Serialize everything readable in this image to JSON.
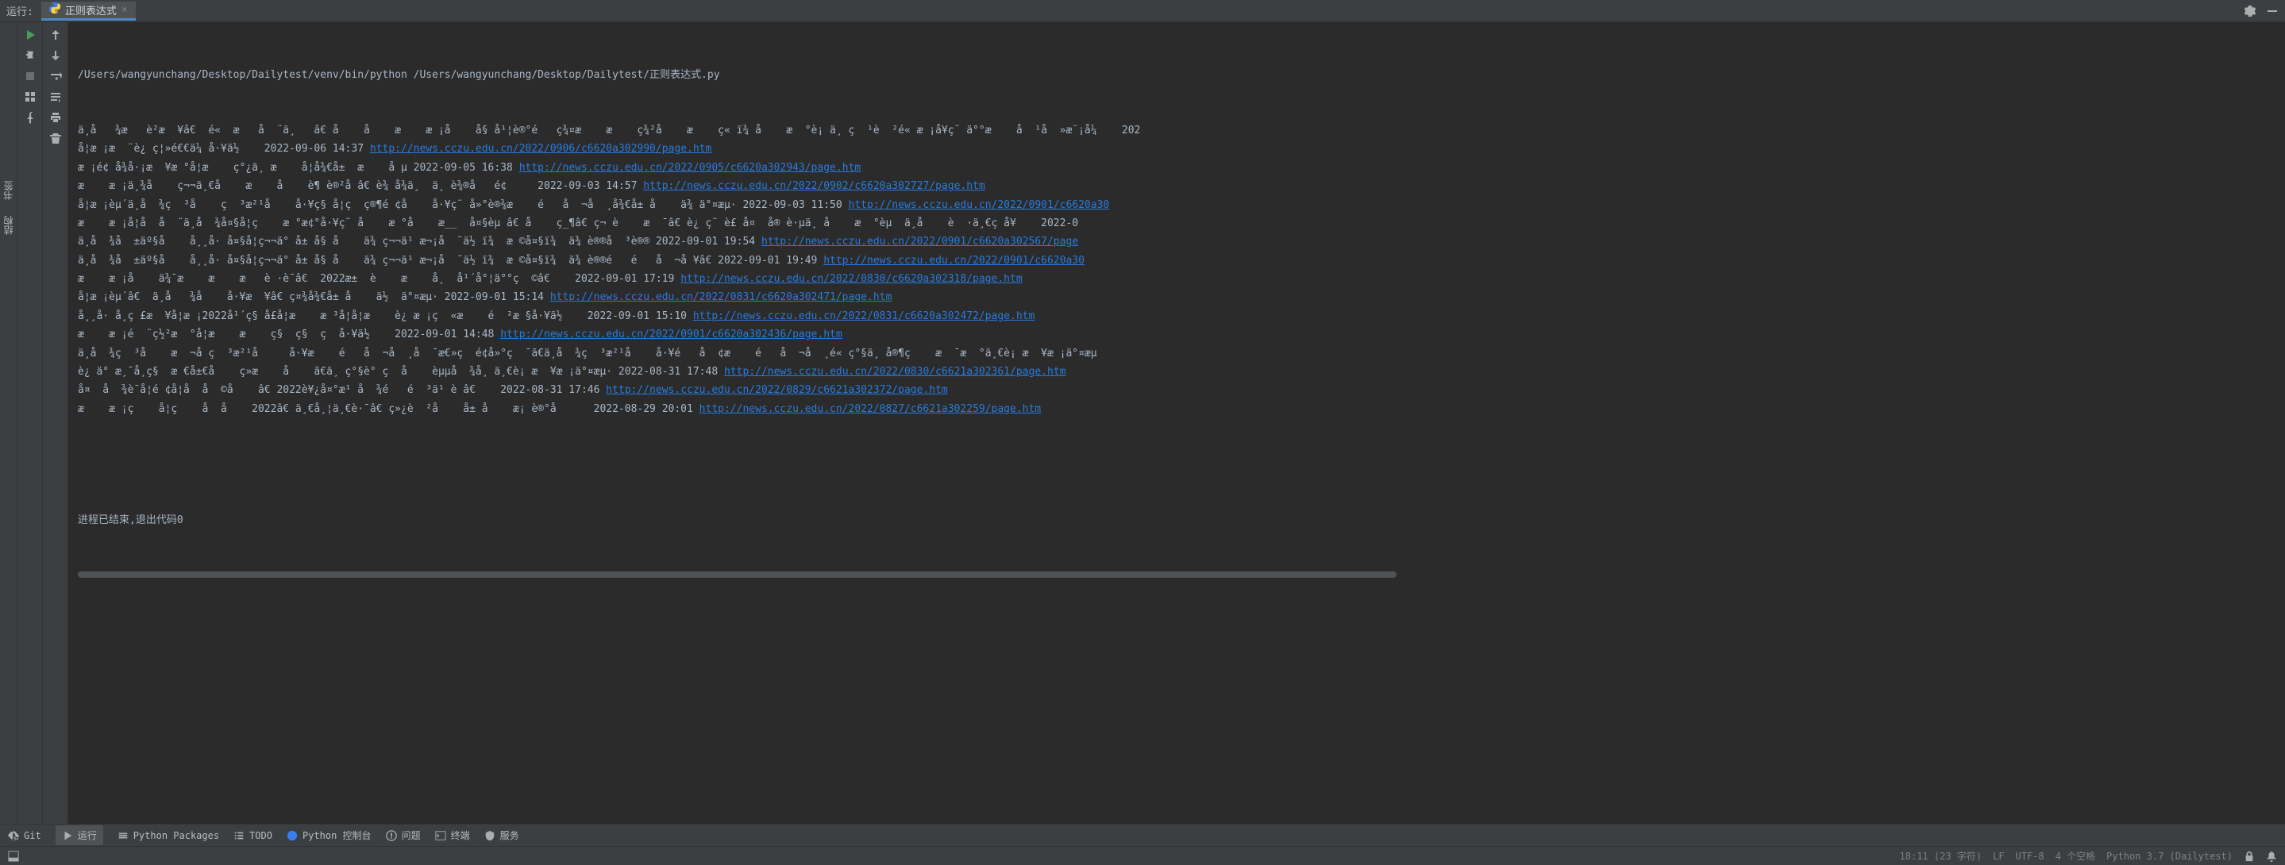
{
  "header": {
    "run_label": "运行:",
    "tab_name": "正则表达式",
    "close_glyph": "×"
  },
  "console": {
    "command": "/Users/wangyunchang/Desktop/Dailytest/venv/bin/python /Users/wangyunchang/Desktop/Dailytest/正则表达式.py",
    "lines": [
      {
        "text": "ä¸­å   ¾æ   è­²æ  ¥â€  é«  æ   å  ¨ä¸   â€ å    å    æ    æ ¡å    å§ å¹¦è®°é   ç¾¤æ    æ    ç¾²å    æ    ç« ï¾ å    æ  °è¡ ä¸ ç  ¹è  ²é« æ ¡å­¥ç¨ ä°°æ    å  ¹å  »æ¨¡å¼    202",
        "url": ""
      },
      {
        "text": "å­¦æ ¡æ  ¨è¿ ç¦»é€€ä¼ å·¥ä½    2022-09-06 14:37 ",
        "url": "http://news.cczu.edu.cn/2022/0906/c6620a302990/page.htm"
      },
      {
        "text": "æ ¡é¢ å­¾å·¡æ  ¥æ °å­¦æ    ç°¿ä¸ æ    å­¦å¾€å±  æ    å µ 2022-09-05 16:38 ",
        "url": "http://news.cczu.edu.cn/2022/0905/c6620a302943/page.htm"
      },
      {
        "text": "æ    æ ¡ä¸¾å    ç¬¬ä¸€å    æ    å    è¶ è®²å ­â€ è¾ å­¾ä¸  ä¸ è¾®å   é¢     2022-09-03 14:57 ",
        "url": "http://news.cczu.edu.cn/2022/0902/c6620a302727/page.htm"
      },
      {
        "text": "å­¦æ ¡èµ´ä¸­å  ¾ç  ³å    ç  ³æ²¹å    å·¥ç§ å­¦ç  ç®¶é ¢å    å·¥ç¨ å»°è®¾æ    é   å  ¬å  ¸å¾€å± å    ä¾ ä°¤æµ· 2022-09-03 11:50 ",
        "url": "http://news.cczu.edu.cn/2022/0901/c6620a30"
      },
      {
        "text": "æ    æ ¡å­¦å­  å  ¨ä¸­å  ¾å¤§å­¦ç    æ °æ¢°å·¥ç¨ å    æ °å    æ__  å¤§èµ â€ å    ç_¶â€ ç¬ è    æ  ¯â€ è¿ ç¨ è£ å¤  å® è·µä¸ å    æ  °èµ  ä¸­å    è  ·ä¸€ç­ å¥    2022-0",
        "url": ""
      },
      {
        "text": "ä¸­å  ¾å  ±äº§å    å¸¸å· å¤§å­¦ç¬¬ä° å± å§ å    ä¾ ç¬¬ä¹ æ¬¡å  ¨ä½ ï¾  æ ©å¤§ï¾  ä¾ è®®å  ³è®® 2022-09-01 19:54 ",
        "url": "http://news.cczu.edu.cn/2022/0901/c6620a302567/page"
      },
      {
        "text": "ä¸­å  ¾å  ±äº§å    å¸¸å· å¤§å­¦ç¬¬ä° å± å§ å    ä¾ ç¬¬ä¹ æ¬¡å  ¨ä½ ï¾  æ ©å¤§ï¾  ä¾ è®®é   é   å  ¬å ¥â€ 2022-09-01 19:49 ",
        "url": "http://news.cczu.edu.cn/2022/0901/c6620a30"
      },
      {
        "text": "æ    æ ¡å    ä¾¯æ    æ    æ   è ·è¯­â€  2022æ±  è    æ    å¸  å¹´å°¦ä°°ç  ©â€    2022-09-01 17:19 ",
        "url": "http://news.cczu.edu.cn/2022/0830/c6620a302318/page.htm"
      },
      {
        "text": "å­¦æ ¡èµ´â€  ä¸­å   ¾å    å·¥æ  ¥â€ ç¤¾å¾€å± å    ä½  ä°¤æµ· 2022-09-01 15:14 ",
        "url": "http://news.cczu.edu.cn/2022/0831/c6620a302471/page.htm"
      },
      {
        "text": "å¸¸å· å¸­ç £æ  ¥å­¦æ ¡2022å¹´ç§ å­£å­¦æ    æ ³å­¦å­¦æ    è¿ æ ¡ç  «æ    é  ²æ §å·¥ä½    2022-09-01 15:10 ",
        "url": "http://news.cczu.edu.cn/2022/0831/c6620a302472/page.htm"
      },
      {
        "text": "æ    æ ¡é  ¨ç½²æ  °å­¦æ    æ    ç§  ç§  ç  å·¥ä½    2022-09-01 14:48 ",
        "url": "http://news.cczu.edu.cn/2022/0901/c6620a302436/page.htm"
      },
      {
        "text": "ä¸­å  ¾ç  ³å    æ  ¬å­ ç  ³æ²¹å     å·¥æ    é   å  ¬å  ¸å  ¯æ€»ç  é­¢å»°ç  ¯ã€ä¸­å  ¾ç  ³æ²¹å    å·¥é   å  ¢æ    é   å  ¬å  ¸é« ç°§ä¸ å®¶ç    æ  ¯æ  °ä¸€è¡ æ  ¥æ ¡ä°¤æµ",
        "url": ""
      },
      {
        "text": "è¿ ä° æ¸¯å¸­ç§  æ €å±€å    ç»­æ    å    ã€ä¸ ç°§è° ç  å    èµµå  ¾å¸ ä¸€è¡ æ  ¥æ ¡ä°¤æµ· 2022-08-31 17:48 ",
        "url": "http://news.cczu.edu.cn/2022/0830/c6621a302361/page.htm"
      },
      {
        "text": "å¤  å  ¾è¯­å­¦é ¢å­¦å­  å  ©å    â€ 2022è¥¿å¤°æ¹ å  ¾é   é  ³ä¹ è ­â€    2022-08-31 17:46 ",
        "url": "http://news.cczu.edu.cn/2022/0829/c6621a302372/page.htm"
      },
      {
        "text": "æ    æ ¡ç    å­¦ç    å  ­å    2022â€ ä¸€å¸¦ä¸€è·¯â€ ç»¿è  ²å    å± å    æ¡ è®°å      2022-08-29 20:01 ",
        "url": "http://news.cczu.edu.cn/2022/0827/c6621a302259/page.htm"
      }
    ],
    "exit_message": "进程已结束,退出代码0"
  },
  "bottom_tabs": {
    "git": "Git",
    "run": "运行",
    "packages": "Python Packages",
    "todo": "TODO",
    "console": "Python 控制台",
    "problems": "问题",
    "terminal": "终端",
    "services": "服务"
  },
  "status": {
    "position": "18:11 (23 字符)",
    "line_sep": "LF",
    "encoding": "UTF-8",
    "indent": "4 个空格",
    "interpreter": "Python 3.7 (Dailytest)"
  },
  "vertical": {
    "bookmarks": "书签",
    "structure": "结构"
  }
}
